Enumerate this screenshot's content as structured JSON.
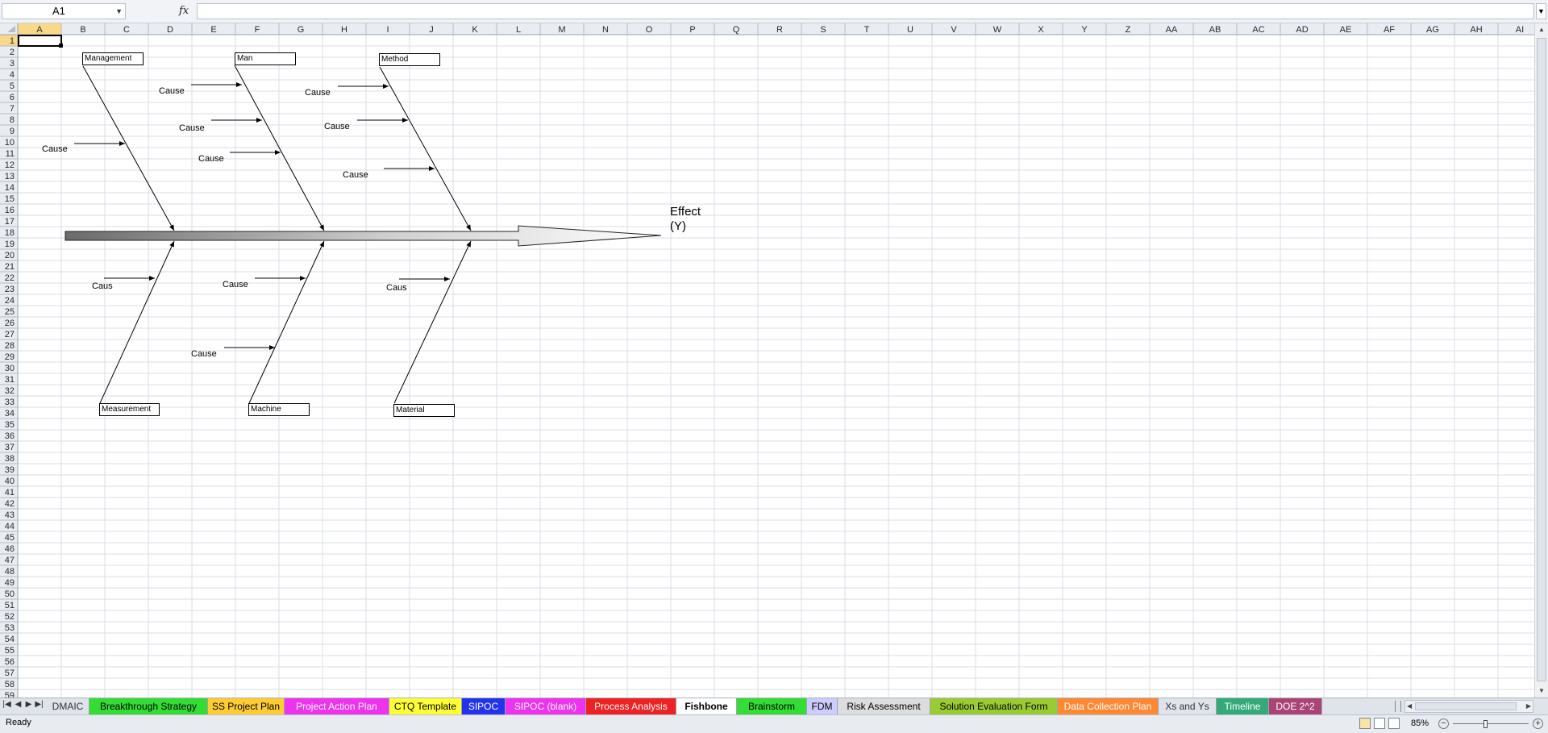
{
  "formula_bar": {
    "name_box": "A1",
    "fx_label": "fx",
    "formula": ""
  },
  "columns": [
    "A",
    "B",
    "C",
    "D",
    "E",
    "F",
    "G",
    "H",
    "I",
    "J",
    "K",
    "L",
    "M",
    "N",
    "O",
    "P",
    "Q",
    "R",
    "S",
    "T",
    "U",
    "V",
    "W",
    "X",
    "Y",
    "Z",
    "AA",
    "AB",
    "AC",
    "AD",
    "AE",
    "AF",
    "AG",
    "AH",
    "AI"
  ],
  "rows": [
    "1",
    "2",
    "3",
    "4",
    "5",
    "6",
    "7",
    "8",
    "9",
    "10",
    "11",
    "12",
    "13",
    "14",
    "15",
    "16",
    "17",
    "18",
    "19",
    "20",
    "21",
    "22",
    "23",
    "24",
    "25",
    "26",
    "27",
    "28",
    "29",
    "30",
    "31",
    "32",
    "33",
    "34",
    "35",
    "36",
    "37",
    "38",
    "39",
    "40",
    "41",
    "42",
    "43",
    "44",
    "45",
    "46",
    "47",
    "48",
    "49",
    "50",
    "51",
    "52",
    "53",
    "54",
    "55",
    "56",
    "57",
    "58",
    "59"
  ],
  "selected_cell": {
    "column": "A",
    "row": "1"
  },
  "fishbone": {
    "categories": {
      "management": "Management",
      "man": "Man",
      "method": "Method",
      "measurement": "Measurement",
      "machine": "Machine",
      "material": "Material"
    },
    "causes": {
      "mgmt_1": "Cause",
      "man_1": "Cause",
      "man_2": "Cause",
      "man_3": "Cause",
      "method_1": "Cause",
      "method_2": "Cause",
      "method_3": "Cause",
      "meas_1": "Caus",
      "machine_1": "Cause",
      "machine_2": "Cause",
      "material_1": "Caus"
    },
    "effect_line1": "Effect",
    "effect_line2": "(Y)"
  },
  "sheet_tabs": [
    {
      "label": "DMAIC",
      "color": "#dfe3ea",
      "text": "#333333"
    },
    {
      "label": "Breakthrough Strategy",
      "color": "#33dd33",
      "text": "#000000"
    },
    {
      "label": "SS Project Plan",
      "color": "#ffcc33",
      "text": "#000000"
    },
    {
      "label": "Project Action Plan",
      "color": "#ee33ee",
      "text": "#ffffff"
    },
    {
      "label": "CTQ Template",
      "color": "#ffff33",
      "text": "#000000"
    },
    {
      "label": "SIPOC",
      "color": "#2233ee",
      "text": "#ffffff"
    },
    {
      "label": "SIPOC (blank)",
      "color": "#ee33ee",
      "text": "#ffffff"
    },
    {
      "label": "Process Analysis",
      "color": "#ee2222",
      "text": "#ffffff"
    },
    {
      "label": "Fishbone",
      "color": "#ffffff",
      "text": "#000000",
      "active": true
    },
    {
      "label": "Brainstorm",
      "color": "#33dd33",
      "text": "#000000"
    },
    {
      "label": "FDM",
      "color": "#ccccff",
      "text": "#000000"
    },
    {
      "label": "Risk Assessment",
      "color": "#dddddd",
      "text": "#000000"
    },
    {
      "label": "Solution Evaluation Form",
      "color": "#99cc33",
      "text": "#000000"
    },
    {
      "label": "Data Collection Plan",
      "color": "#ff8833",
      "text": "#ffffff"
    },
    {
      "label": "Xs and Ys",
      "color": "#dfe3ea",
      "text": "#333333"
    },
    {
      "label": "Timeline",
      "color": "#33aa77",
      "text": "#ffffff"
    },
    {
      "label": "DOE 2^2",
      "color": "#aa4477",
      "text": "#ffffff"
    }
  ],
  "status_bar": {
    "ready": "Ready",
    "zoom": "85%",
    "zoom_fraction": 0.85
  },
  "colors": {
    "grid_line": "#d9dde3",
    "header_bg": "#e9edf2",
    "header_selected": "#f8d98a",
    "selection_border": "#000000"
  }
}
